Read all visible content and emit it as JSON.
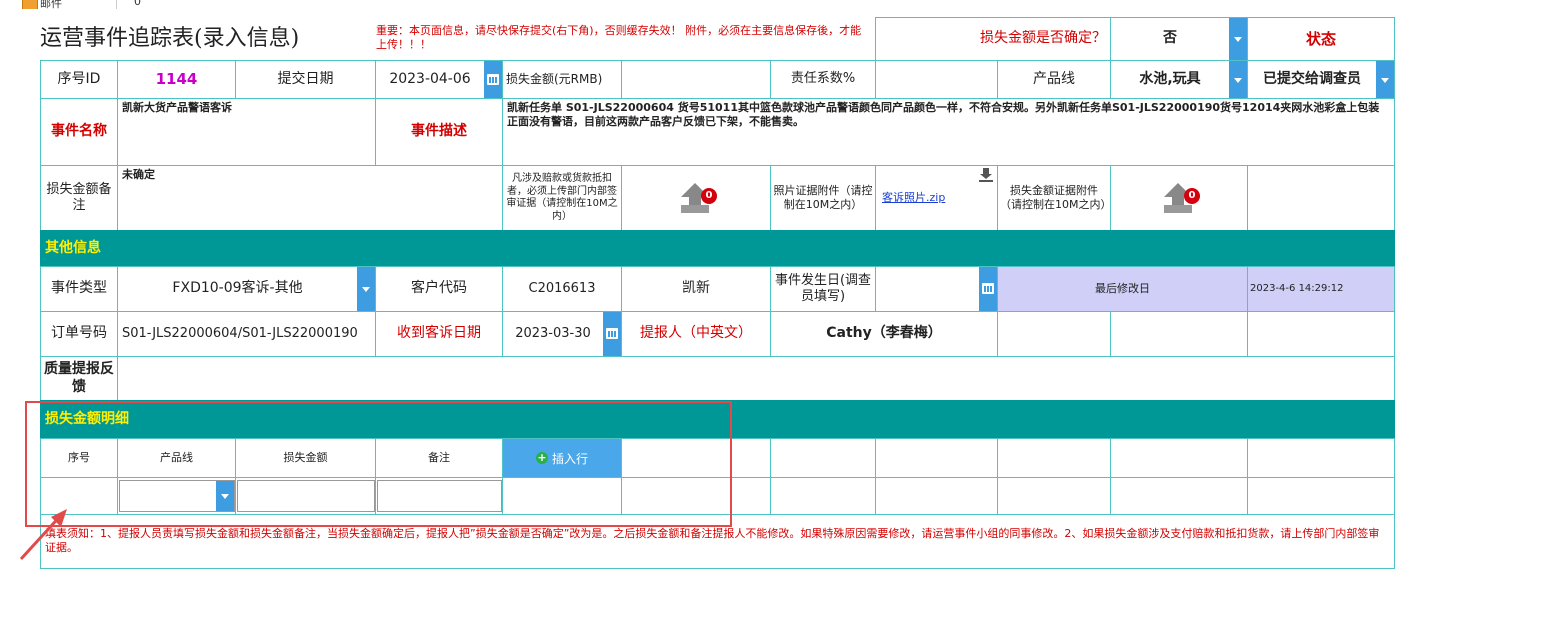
{
  "topbar": {
    "mail_label": "邮件",
    "count": "0"
  },
  "title": "运营事件追踪表(录入信息)",
  "warning": "重要：本页面信息，请尽快保存提交(右下角)，否则缓存失效！ 附件，必须在主要信息保存後，才能上传！！！",
  "loss_confirmed": {
    "label": "损失金额是否确定？",
    "value": "否"
  },
  "status": {
    "label": "状态",
    "value": "已提交给调查员"
  },
  "row1": {
    "seq_label": "序号ID",
    "seq_value": "1144",
    "submit_label": "提交日期",
    "submit_value": "2023-04-06",
    "loss_amount_label": "损失金额(元RMB)",
    "loss_amount_value": "",
    "resp_label": "责任系数%",
    "resp_value": "",
    "product_line_label": "产品线",
    "product_line_value": "水池,玩具"
  },
  "event": {
    "name_label": "事件名称",
    "name_value": "凯新大货产品警语客诉",
    "desc_label": "事件描述",
    "desc_value": "凯新任务单 S01-JLS22000604 货号51011其中篮色款球池产品警语颜色同产品颜色一样，不符合安规。另外凯新任务单S01-JLS22000190货号12014夹网水池彩盒上包装正面没有警语，目前这两款产品客户反馈已下架，不能售卖。"
  },
  "attach_row": {
    "loss_note_label": "损失金额备注",
    "loss_note_value": "未确定",
    "compensation_note": "凡涉及赔款或货款抵扣者，必须上传部门内部签审证据（请控制在10M之内）",
    "upload_count_1": "0",
    "photo_label": "照片证据附件（请控制在10M之内）",
    "photo_file": "客诉照片.zip",
    "loss_evidence_label": "损失金额证据附件（请控制在10M之内）",
    "upload_count_2": "0"
  },
  "other_info": {
    "header": "其他信息",
    "event_type_label": "事件类型",
    "event_type_value": "FXD10-09客诉-其他",
    "customer_code_label": "客户代码",
    "customer_code_value": "C2016613",
    "customer_name": "凯新",
    "occur_date_label": "事件发生日(调查员填写)",
    "occur_date_value": "",
    "last_modified_label": "最后修改日",
    "last_modified_value": "2023-4-6 14:29:12",
    "order_label": "订单号码",
    "order_value": "S01-JLS22000604/S01-JLS22000190",
    "complaint_date_label": "收到客诉日期",
    "complaint_date_value": "2023-03-30",
    "reporter_label": "提报人（中英文）",
    "reporter_value": "Cathy（李春梅）",
    "quality_label": "质量提报反馈",
    "quality_value": ""
  },
  "loss_detail": {
    "header": "损失金额明细",
    "col_seq": "序号",
    "col_product": "产品线",
    "col_amount": "损失金额",
    "col_note": "备注",
    "insert_button": "插入行"
  },
  "footer_note": "填表须知：1、提报人员责填写损失金额和损失金额备注，当损失金额确定后，提报人把”损失金额是否确定”改为是。之后损失金额和备注提报人不能修改。如果特殊原因需要修改，请运营事件小组的同事修改。2、如果损失金额涉及支付赔款和抵扣货款，请上传部门内部签审证据。"
}
